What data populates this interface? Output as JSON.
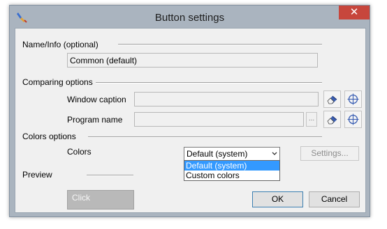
{
  "window": {
    "title": "Button settings",
    "close_glyph": "✕",
    "app_icon": "paintbrush-icon"
  },
  "name_info": {
    "label": "Name/Info (optional)",
    "value": "Common (default)"
  },
  "comparing": {
    "label": "Comparing options",
    "window_caption_label": "Window caption",
    "window_caption_value": "",
    "program_name_label": "Program name",
    "program_name_value": "",
    "browse_label": "..."
  },
  "colors_section": {
    "label": "Colors options",
    "colors_label": "Colors",
    "selected": "Default (system)",
    "options": [
      "Default (system)",
      "Custom colors"
    ],
    "settings_button": "Settings..."
  },
  "preview": {
    "label": "Preview",
    "button_text": "Click",
    "button_bg": "#b9b9b9"
  },
  "buttons": {
    "ok": "OK",
    "cancel": "Cancel"
  },
  "colors": {
    "close_red": "#c7463c",
    "frame": "#aab4bf",
    "selection_blue": "#3399ff"
  }
}
